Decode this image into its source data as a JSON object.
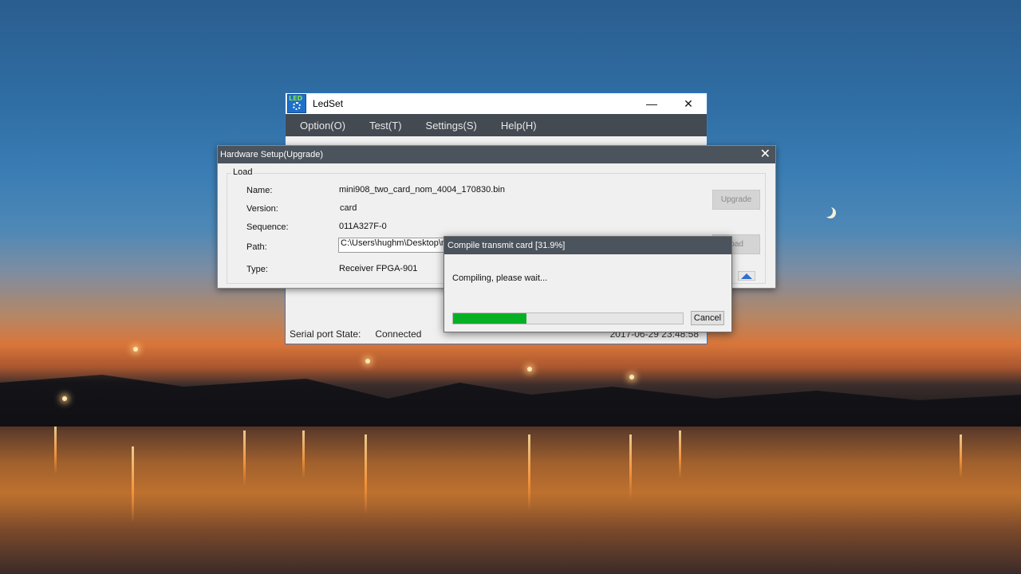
{
  "ledset": {
    "title": "LedSet",
    "icon": "led-gear-icon",
    "minimize_label": "—",
    "close_label": "✕",
    "menu": [
      {
        "label": "Option(O)"
      },
      {
        "label": "Test(T)"
      },
      {
        "label": "Settings(S)"
      },
      {
        "label": "Help(H)"
      }
    ],
    "status": {
      "label": "Serial port State:",
      "value": "Connected",
      "time": "2017-06-29 23:48:58"
    }
  },
  "hardware_setup": {
    "title": "Hardware Setup(Upgrade)",
    "close_label": "✕",
    "group_title": "Load",
    "fields": {
      "name_label": "Name:",
      "name_value": "mini908_two_card_nom_4004_170830.bin",
      "version_label": "Version:",
      "version_value": "card",
      "sequence_label": "Sequence:",
      "sequence_value": "011A327F-0",
      "path_label": "Path:",
      "path_value": "C:\\Users\\hughm\\Desktop\\mini9",
      "type_label": "Type:",
      "type_value": "Receiver FPGA-901"
    },
    "upgrade_label": "Upgrade",
    "load_label": "oad"
  },
  "compile_dialog": {
    "title": "Compile transmit card [31.9%]",
    "message": "Compiling, please wait...",
    "progress_percent": 31.9,
    "cancel_label": "Cancel",
    "accent": "#06b025"
  }
}
